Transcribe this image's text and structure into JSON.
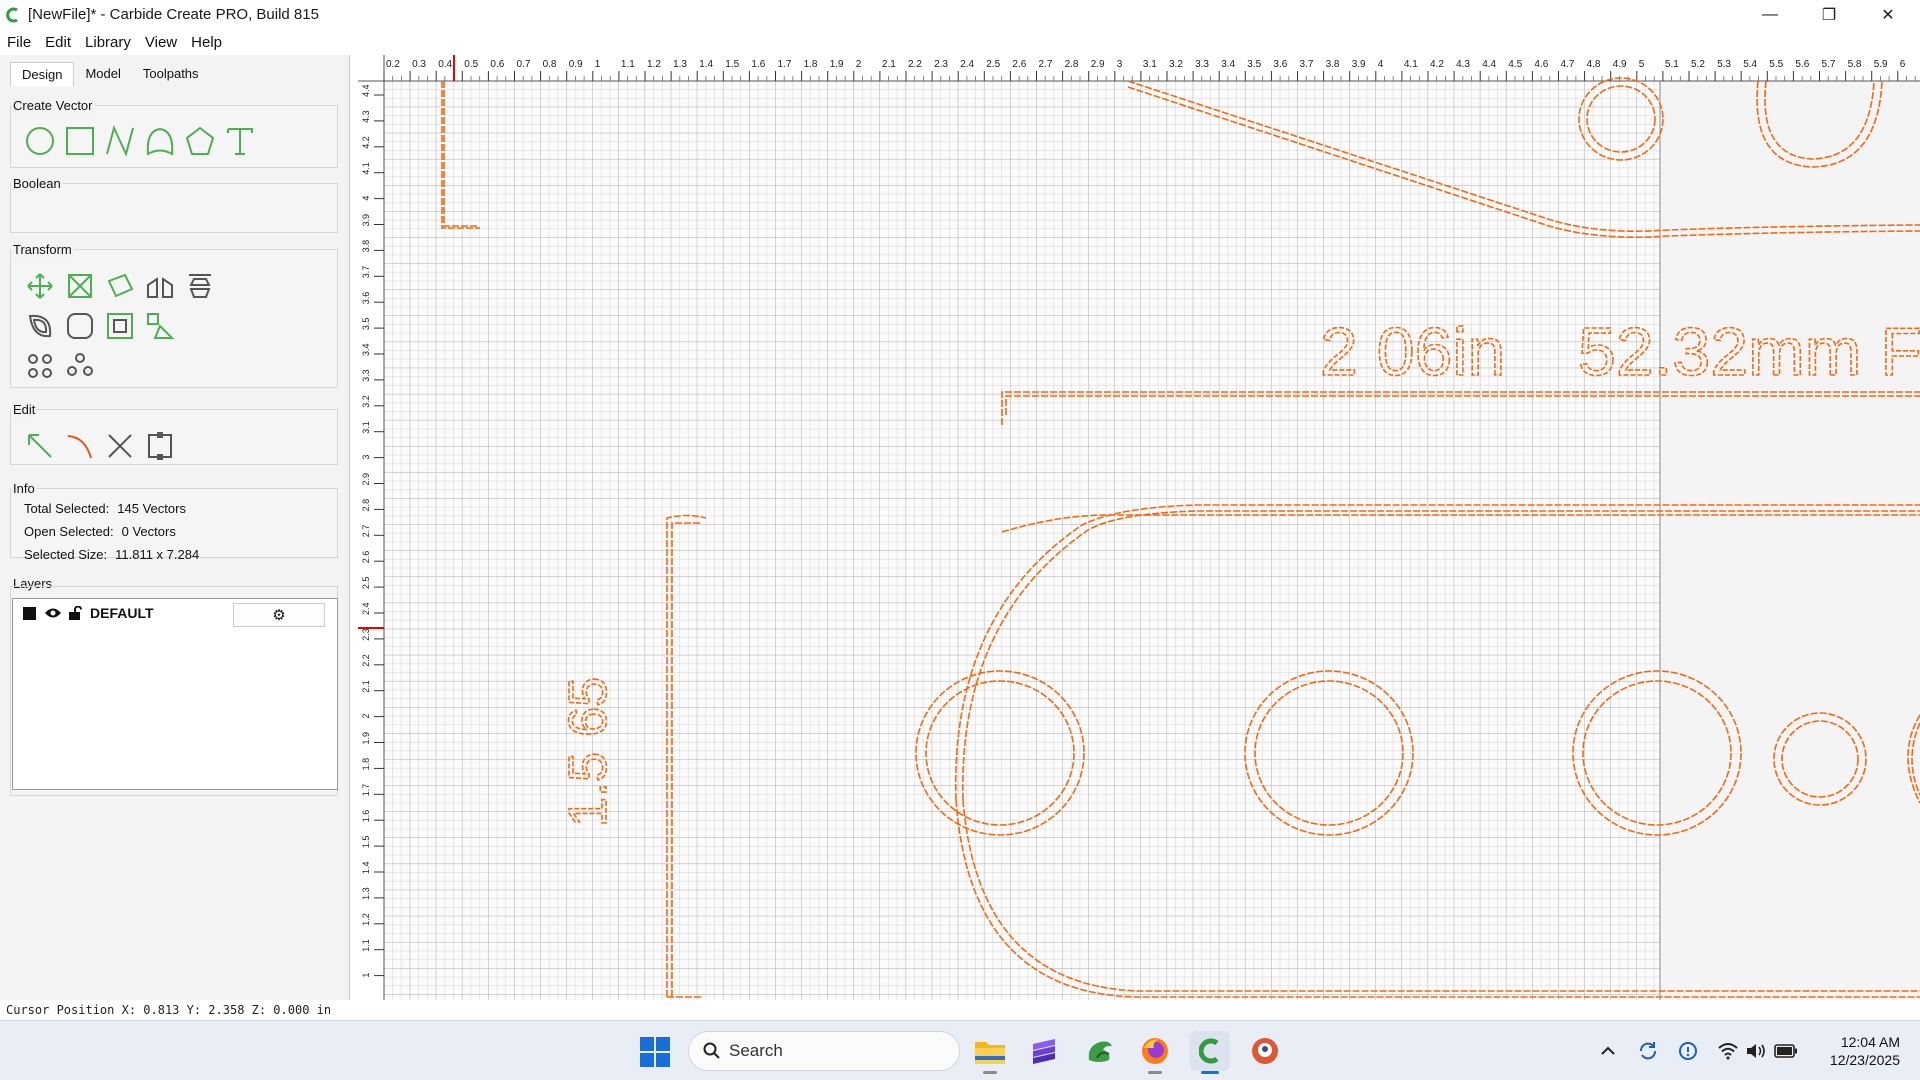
{
  "window": {
    "title": "[NewFile]* - Carbide Create PRO, Build 815",
    "minimize": "—",
    "maximize": "❐",
    "close": "✕"
  },
  "menu": [
    "File",
    "Edit",
    "Library",
    "View",
    "Help"
  ],
  "tabs": [
    "Design",
    "Model",
    "Toolpaths"
  ],
  "sections": {
    "create_vector": "Create Vector",
    "boolean": "Boolean",
    "transform": "Transform",
    "edit": "Edit",
    "info": "Info",
    "layers": "Layers"
  },
  "info": {
    "total_selected_label": "Total Selected:",
    "total_selected_value": "145 Vectors",
    "open_selected_label": "Open Selected:",
    "open_selected_value": "0 Vectors",
    "selected_size_label": "Selected Size:",
    "selected_size_value": "11.811 x 7.284"
  },
  "layers": [
    {
      "name": "DEFAULT",
      "color": "#111111"
    }
  ],
  "status": "Cursor Position X: 0.813 Y: 2.358 Z: 0.000 in",
  "canvas": {
    "text_left": "2 06in",
    "text_right": "52.32mm F",
    "vertical_text": "1.5 65",
    "vector_color": "#f26a10",
    "cursor_x": 0.813,
    "cursor_y": 2.358
  },
  "taskbar": {
    "search_placeholder": "Search",
    "time": "12:04 AM",
    "date": "12/23/2025"
  }
}
